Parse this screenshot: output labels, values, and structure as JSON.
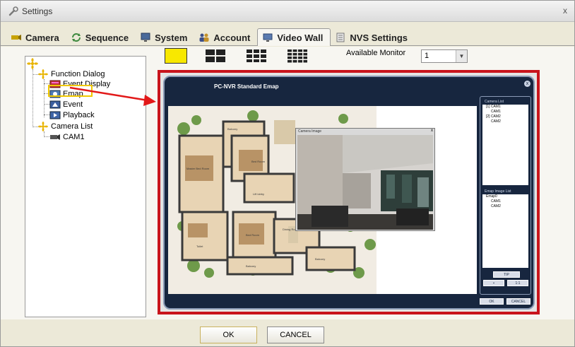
{
  "window": {
    "title": "Settings",
    "close": "x"
  },
  "tabs": [
    {
      "label": "Camera",
      "icon": "camera-icon"
    },
    {
      "label": "Sequence",
      "icon": "sequence-icon"
    },
    {
      "label": "System",
      "icon": "monitor-icon"
    },
    {
      "label": "Account",
      "icon": "users-icon"
    },
    {
      "label": "Video Wall",
      "icon": "video-wall-icon",
      "active": true
    },
    {
      "label": "NVS Settings",
      "icon": "document-icon"
    }
  ],
  "tree": {
    "items": [
      {
        "label": "Function Dialog",
        "icon": "folder-icon"
      },
      {
        "label": "Event Display",
        "icon": "event-display-icon"
      },
      {
        "label": "Emap",
        "icon": "emap-icon",
        "selected": true
      },
      {
        "label": "Event",
        "icon": "event-icon"
      },
      {
        "label": "Playback",
        "icon": "playback-icon"
      },
      {
        "label": "Camera List",
        "icon": "folder-icon"
      },
      {
        "label": "CAM1",
        "icon": "camera-icon"
      }
    ]
  },
  "toolbar": {
    "available_monitor_label": "Available Monitor",
    "monitor_value": "1"
  },
  "emap": {
    "title": "PC-NVR Standard  Emap",
    "close": "x",
    "popup_title": "Camera Image",
    "popup_close": "x",
    "camera_list": {
      "header": "Camera List",
      "items": [
        "[1] CAM1",
        "CAM1",
        "[2] CAM2",
        "CAM2"
      ]
    },
    "emap_list": {
      "header": "Emap Image List",
      "items": [
        "Emap0",
        "CAM1",
        "CAM2"
      ]
    },
    "controls": {
      "top": "TIP",
      "ratio": "1:1",
      "ok": "OK",
      "cancel": "CANCEL"
    }
  },
  "buttons": {
    "ok": "OK",
    "cancel": "CANCEL"
  },
  "colors": {
    "accent_red": "#c8141c",
    "highlight_yellow": "#f8e800",
    "emap_navy": "#17263f"
  }
}
